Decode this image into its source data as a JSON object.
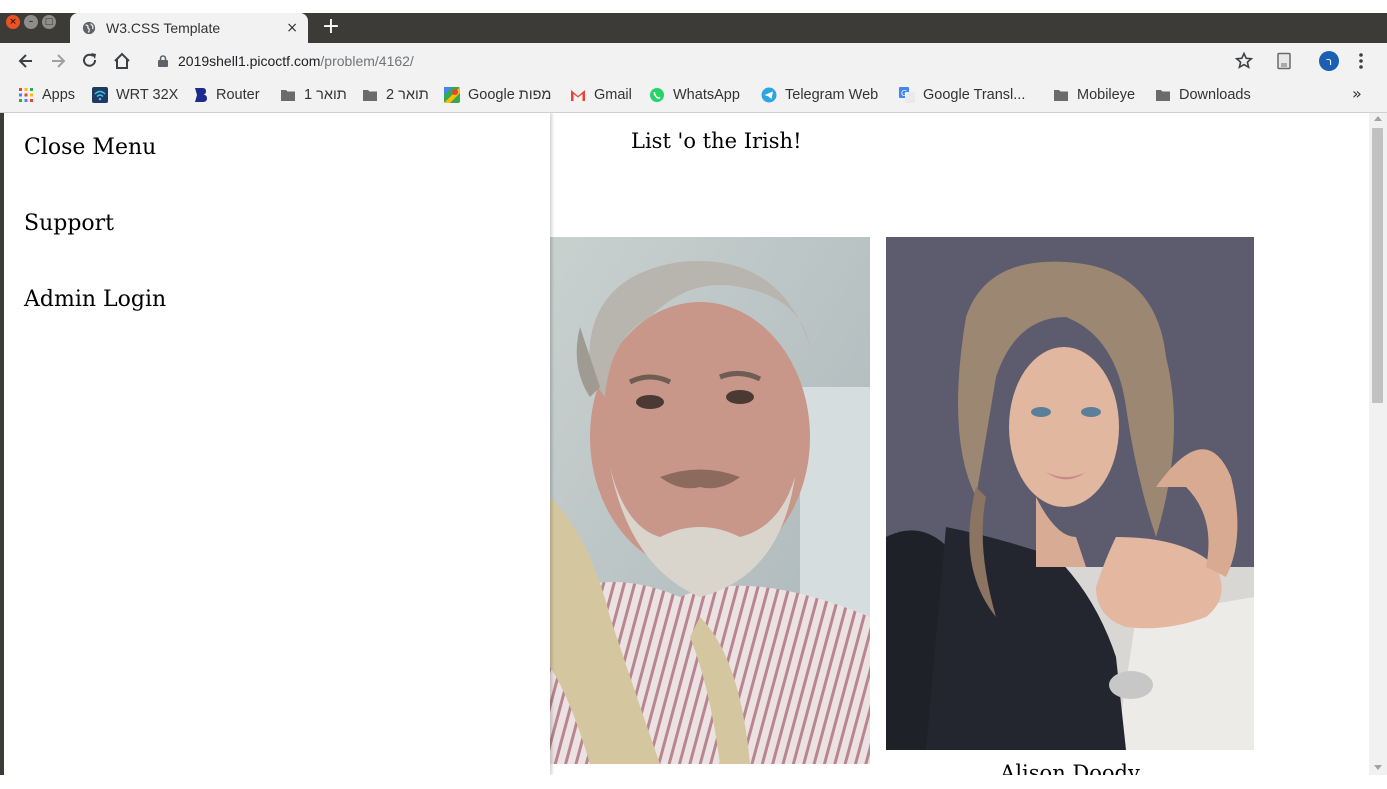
{
  "browser": {
    "tab_title": "W3.CSS Template",
    "tab_close": "×",
    "new_tab": "+",
    "url_host": "2019shell1.picoctf.com",
    "url_path": "/problem/4162/",
    "profile_initial": "ר",
    "bookmarks": [
      {
        "label": "Apps",
        "icon": "apps-grid-icon"
      },
      {
        "label": "WRT 32X",
        "icon": "wifi-icon"
      },
      {
        "label": "Router",
        "icon": "router-icon"
      },
      {
        "label": "תואר 1",
        "icon": "folder-icon"
      },
      {
        "label": "תואר 2",
        "icon": "folder-icon"
      },
      {
        "label": "Google מפות",
        "icon": "maps-icon"
      },
      {
        "label": "Gmail",
        "icon": "gmail-icon"
      },
      {
        "label": "WhatsApp",
        "icon": "whatsapp-icon"
      },
      {
        "label": "Telegram Web",
        "icon": "telegram-icon"
      },
      {
        "label": "Google Transl...",
        "icon": "translate-icon"
      },
      {
        "label": "Mobileye",
        "icon": "folder-icon"
      },
      {
        "label": "Downloads",
        "icon": "folder-icon"
      }
    ],
    "bookmarks_overflow": "»"
  },
  "sidebar": {
    "close_menu": "Close Menu",
    "support": "Support",
    "admin_login": "Admin Login"
  },
  "main": {
    "title": "List 'o the Irish!",
    "cards": [
      {
        "caption": "",
        "image": "bearded-man-photo"
      },
      {
        "caption": "Alison Doody",
        "image": "woman-portrait-photo"
      }
    ]
  },
  "colors": {
    "titlebar": "#3c3b37",
    "toolbar": "#f2f2f2",
    "profile": "#1a5fb4",
    "close_button": "#e95420"
  }
}
